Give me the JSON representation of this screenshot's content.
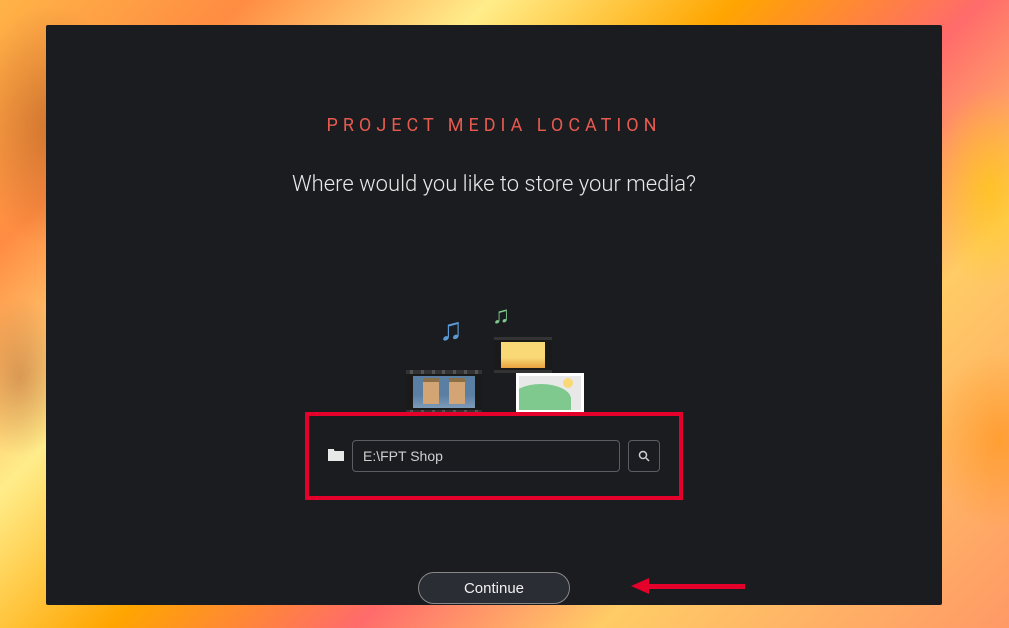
{
  "title": "PROJECT MEDIA LOCATION",
  "subtitle": "Where would you like to store your media?",
  "path_value": "E:\\FPT Shop",
  "continue_label": "Continue",
  "icons": {
    "folder": "folder-icon",
    "search": "search-icon",
    "music_note_1": "music-note-icon",
    "music_note_2": "music-note-icon"
  },
  "annotation": {
    "highlight_box": "red",
    "arrow_color": "#e4002b"
  }
}
